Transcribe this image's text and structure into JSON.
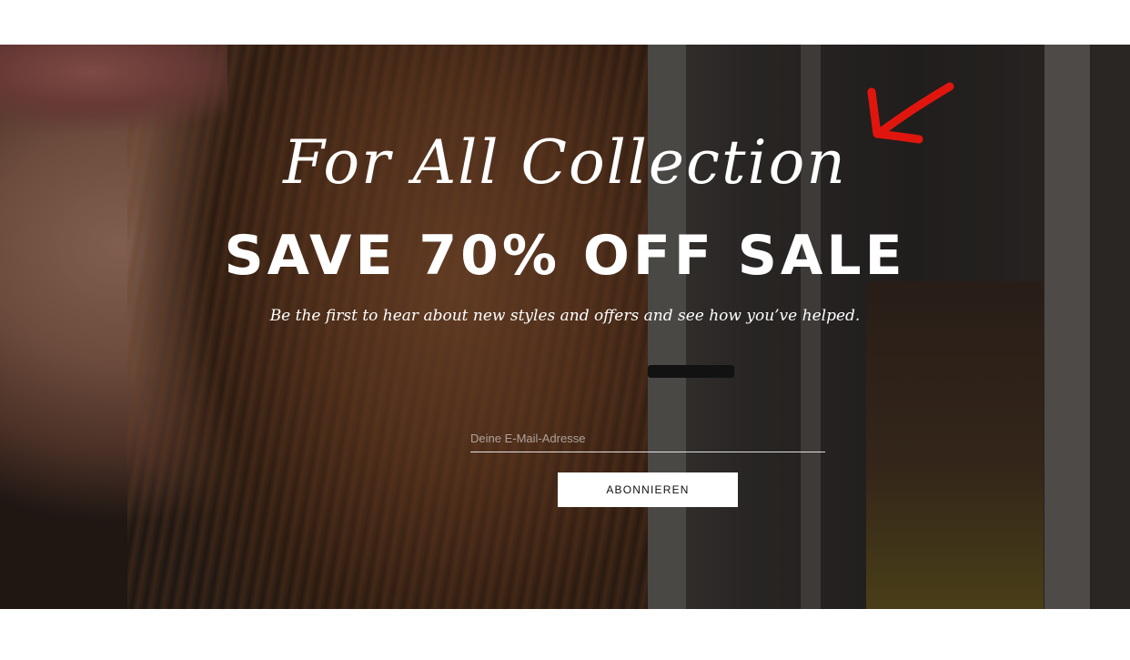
{
  "hero": {
    "script_title": "For All Collection",
    "headline": "SAVE 70% OFF SALE",
    "subtitle": "Be the first to hear about new styles and offers and see how you’ve helped.",
    "arrow_icon": "arrow-down-left-icon",
    "arrow_color": "#e0160e"
  },
  "newsletter": {
    "email_placeholder": "Deine E-Mail-Adresse",
    "email_value": "",
    "subscribe_label": "ABONNIEREN"
  },
  "colors": {
    "text": "#ffffff",
    "button_bg": "#ffffff",
    "button_text": "#111111",
    "page_bg": "#ffffff"
  }
}
